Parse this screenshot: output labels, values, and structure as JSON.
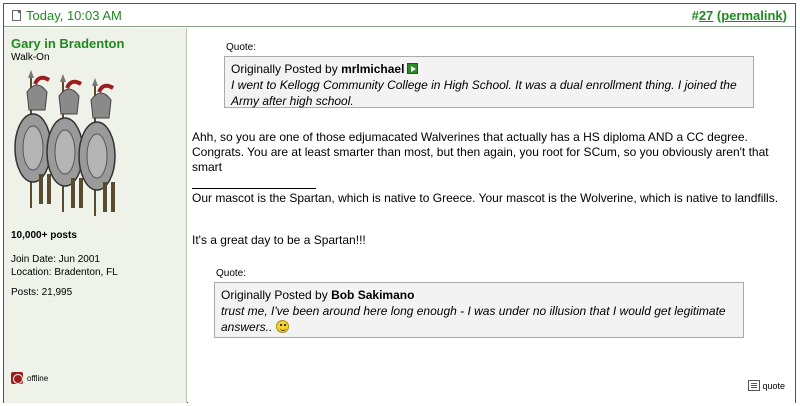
{
  "post": {
    "date": "Today, 10:03 AM",
    "number_prefix": "#",
    "number": "27",
    "permalink_open": " (",
    "permalink": "permalink",
    "permalink_close": ")"
  },
  "user": {
    "name": "Gary in Bradenton",
    "title": "Walk-On",
    "badge": "10,000+ posts",
    "join_date": "Join Date: Jun 2001",
    "location": "Location: Bradenton, FL",
    "posts": "Posts: 21,995",
    "status": "offline"
  },
  "quote1": {
    "label": "Quote:",
    "attrib_prefix": "Originally Posted by ",
    "author": "mrlmichael",
    "text": "I went to Kellogg Community College in High School. It was a dual enrollment thing. I joined the Army after high school."
  },
  "message": {
    "paragraph1": "Ahh, so you are one of those edjumacated Walverines that actually has a HS diploma AND a CC degree. Congrats. You are at least smarter than most, but then again, you root for SCum, so you obviously aren't that smart",
    "signature": "Our mascot is the Spartan, which is native to Greece. Your mascot is the Wolverine, which is native to landfills.",
    "tagline": "It's a great day to be a Spartan!!!"
  },
  "quote2": {
    "label": "Quote:",
    "attrib_prefix": "Originally Posted by ",
    "author": "Bob Sakimano",
    "text": "trust me, I've been around here long enough - I was under no illusion that I would get legitimate answers.. "
  },
  "actions": {
    "quote_label": "quote"
  },
  "icons": {
    "post": "document-icon",
    "view_post": "arrow-right-icon",
    "smiley": "smiley-icon",
    "status": "offline-icon",
    "quote": "quote-icon"
  },
  "colors": {
    "accent": "#1f8a1f",
    "sidebar_bg": "#eef2e8",
    "quote_bg": "#f3f3f3"
  }
}
